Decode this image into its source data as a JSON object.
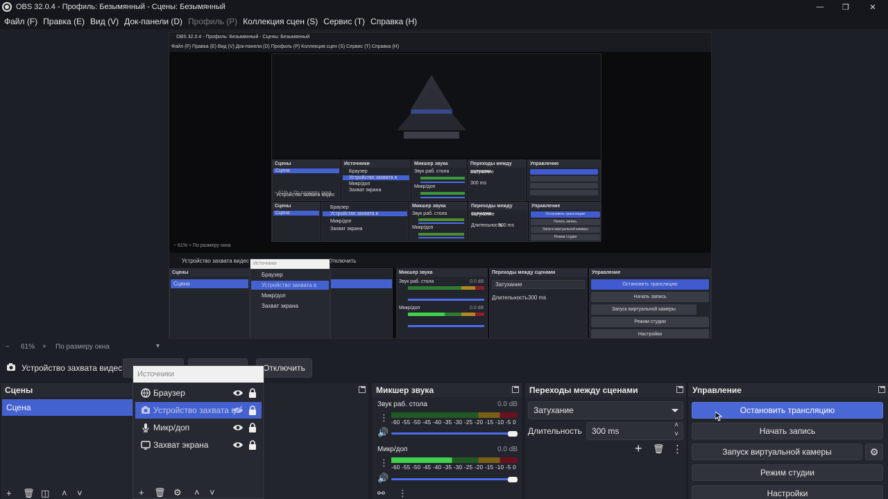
{
  "window": {
    "title": "OBS 32.0.4 - Профиль: Безымянный - Сцены: Безымянный",
    "minimize": "—",
    "maximize": "❐",
    "close": "✕"
  },
  "menu": [
    {
      "label": "Файл (F)",
      "enabled": true
    },
    {
      "label": "Правка (E)",
      "enabled": true
    },
    {
      "label": "Вид (V)",
      "enabled": true
    },
    {
      "label": "Док-панели (D)",
      "enabled": true
    },
    {
      "label": "Профиль (P)",
      "enabled": false
    },
    {
      "label": "Коллекция сцен (S)",
      "enabled": true
    },
    {
      "label": "Сервис (T)",
      "enabled": true
    },
    {
      "label": "Справка (H)",
      "enabled": true
    }
  ],
  "zoom": {
    "minus": "−",
    "value": "61%",
    "plus": "+",
    "mode": "По размеру окна",
    "dropdown": "▾"
  },
  "source_toolbar": {
    "source_name": "Устройство захвата видес",
    "deactivate_label": "Отключить"
  },
  "scenes": {
    "title": "Сцены",
    "items": [
      {
        "label": "Сцена",
        "selected": true
      }
    ]
  },
  "sources": {
    "header_placeholder": "Источники",
    "items": [
      {
        "label": "Браузер",
        "icon": "globe-icon",
        "visible": true,
        "locked": true,
        "selected": false
      },
      {
        "label": "Устройство захвата в",
        "icon": "camera-icon",
        "visible": false,
        "locked": true,
        "selected": true
      },
      {
        "label": "Микр/доп",
        "icon": "mic-icon",
        "visible": true,
        "locked": true,
        "selected": false
      },
      {
        "label": "Захват экрана",
        "icon": "monitor-icon",
        "visible": true,
        "locked": true,
        "selected": false
      }
    ]
  },
  "mixer": {
    "title": "Микшер звука",
    "channels": [
      {
        "name": "Звук раб. стола",
        "db": "0.0 dB",
        "scale": "-60 -55 -50 -45 -40 -35 -30 -25 -20 -15 -10 -5 0",
        "level": 0.0,
        "volume": 1.0
      },
      {
        "name": "Микр/доп",
        "db": "0.0 dB",
        "scale": "-60 -55 -50 -45 -40 -35 -30 -25 -20 -15 -10 -5 0",
        "level": 0.48,
        "volume": 1.0
      }
    ]
  },
  "transitions": {
    "title": "Переходы между сценами",
    "selected": "Затухание",
    "duration_label": "Длительность",
    "duration_value": "300 ms"
  },
  "controls": {
    "title": "Управление",
    "stop_stream": "Остановить трансляцию",
    "start_record": "Начать запись",
    "virtual_cam": "Запуск виртуальной камеры",
    "studio_mode": "Режим студии",
    "settings": "Настройки"
  },
  "nested": {
    "title": "OBS 32.0.4 - Профиль: Безымянный - Сцены: Безымянный",
    "menu": "Файл (F)   Правка (E)   Вид (V)   Док-панели (D)   Профиль (P)   Коллекция сцен (S)   Сервис (T)   Справка (H)",
    "zoom": "−   61%   +   По размеру окна",
    "source_name": "Устройство захвата видес",
    "deactivate": "Отключить",
    "scenes_title": "Сцены",
    "scene": "Сцена",
    "sources_header": "Источники",
    "sources": [
      "Браузер",
      "Устройство захвата в",
      "Микр/доп",
      "Захват экрана"
    ],
    "mixer_title": "Микшер звука",
    "mixer_ch1": "Звук раб. стола",
    "mixer_ch2": "Микр/доп",
    "db": "0.0 dB",
    "trans_title": "Переходы между сценами",
    "trans_value": "Затухание",
    "duration_label": "Длительность",
    "duration_value": "300 ms",
    "controls_title": "Управление",
    "ctrl": [
      "Остановить трансляцию",
      "Начать запись",
      "Запуск виртуальной камеры",
      "Режим студии",
      "Настройки"
    ]
  }
}
